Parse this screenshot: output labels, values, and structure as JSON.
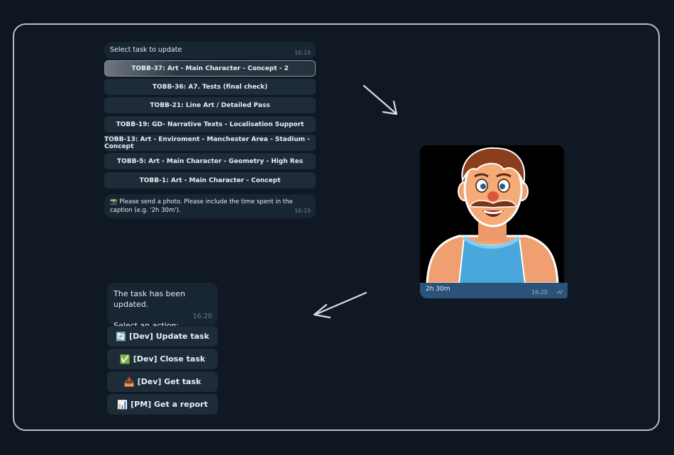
{
  "bot_message_1": {
    "text": "Select task to update",
    "time": "16:19"
  },
  "task_buttons": [
    "TOBB-37: Art - Main Character - Concept - 2",
    "TOBB-36: A7. Tests (final check)",
    "TOBB-21: Line Art / Detailed Pass",
    "TOBB-19: GD- Narrative Texts - Localisation Support",
    "TOBB-13: Art - Enviroment - Manchester Area - Stadium - Concept",
    "TOBB-5: Art - Main Character - Geometry - High Res",
    "TOBB-1: Art - Main Character - Concept"
  ],
  "bot_message_2": {
    "icon": "📸",
    "text": "Please send a photo. Please include the time spent in the caption (e.g. '2h 30m').",
    "time": "16:19"
  },
  "user_photo": {
    "caption": "2h 30m",
    "time": "16:20",
    "status": "read-double-check-icon"
  },
  "bot_message_3": {
    "line1": "The task has been updated.",
    "line2": "Select an action:",
    "time": "16:20"
  },
  "action_buttons": [
    {
      "icon": "🔄",
      "label": "[Dev] Update task"
    },
    {
      "icon": "✅",
      "label": "[Dev] Close task"
    },
    {
      "icon": "📥",
      "label": "[Dev] Get task"
    },
    {
      "icon": "📊",
      "label": "[PM] Get a report"
    }
  ],
  "colors": {
    "background": "#0e1621",
    "bubble": "#182533",
    "button": "#1e2c3a",
    "outgoing": "#2b5278",
    "frame_border": "#b9bec4"
  }
}
